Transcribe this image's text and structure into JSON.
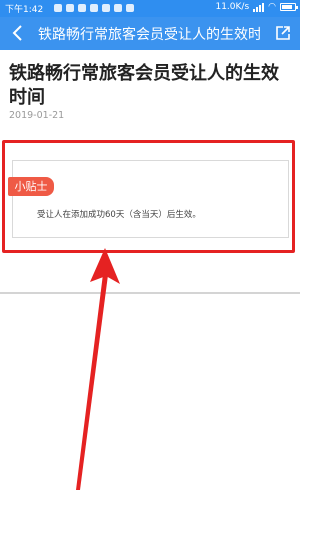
{
  "status_bar": {
    "time": "下午1:42",
    "net_speed": "11.0K/s",
    "battery_level": 0.85
  },
  "app_bar": {
    "title": "铁路畅行常旅客会员受让人的生效时间",
    "back_icon": "back-arrow-icon",
    "share_icon": "share-icon"
  },
  "article": {
    "title": "铁路畅行常旅客会员受让人的生效时间",
    "date": "2019-01-21"
  },
  "tip": {
    "badge": "小贴士",
    "text": "受让人在添加成功60天（含当天）后生效。"
  },
  "colors": {
    "status_bar": "#2f8ef0",
    "app_bar": "#3b93ef",
    "badge": "#ef5a45",
    "annotation_red": "#e52222"
  }
}
